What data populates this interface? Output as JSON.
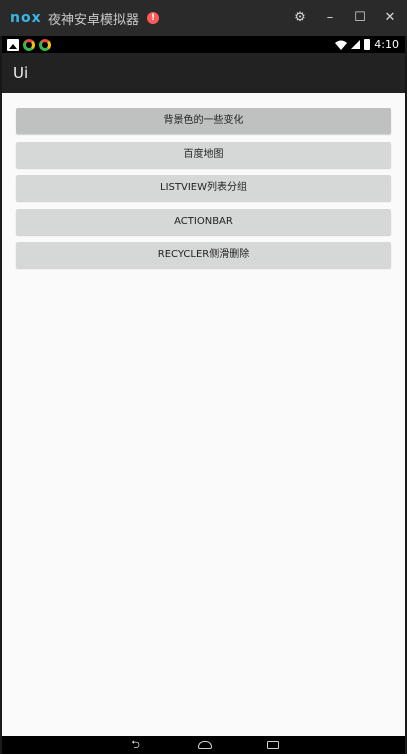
{
  "emulator": {
    "logo": "nox",
    "title": "夜神安卓模拟器",
    "alert": "!",
    "controls": {
      "settings_icon": "gear-icon",
      "minimize_icon": "minimize-icon",
      "maximize_icon": "maximize-icon",
      "close_icon": "close-icon"
    }
  },
  "status_bar": {
    "time": "4:10"
  },
  "app_bar": {
    "title": "Ui"
  },
  "buttons": [
    {
      "label": "背景色的一些变化",
      "pressed": true
    },
    {
      "label": "百度地图",
      "pressed": false
    },
    {
      "label": "LISTVIEW列表分组",
      "pressed": false
    },
    {
      "label": "ACTIONBAR",
      "pressed": false
    },
    {
      "label": "RECYCLER侧滑删除",
      "pressed": false
    }
  ],
  "colors": {
    "nox_brand": "#39b7e7",
    "alert": "#ff5a5a",
    "app_bar": "#222222",
    "content_bg": "#fafafa",
    "button_bg": "#d6d7d7",
    "button_pressed_bg": "#bfc0c0"
  }
}
